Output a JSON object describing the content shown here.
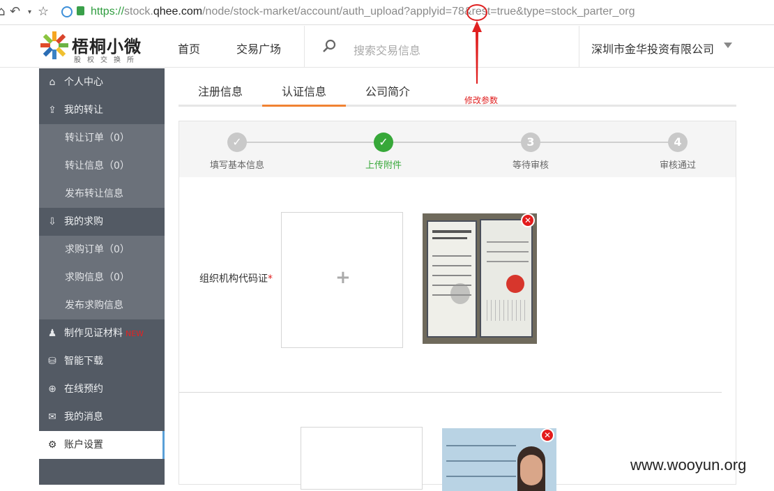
{
  "browser": {
    "url_scheme": "https://",
    "url_host_prefix": "stock.",
    "url_host_domain": "qhee.com",
    "url_path": "/node/stock-market/account/auth_upload?applyid=78&rest=true&type=stock_parter_org"
  },
  "header": {
    "logo_title": "梧桐小微",
    "logo_subtitle": "股权交换所",
    "nav": [
      "首页",
      "交易广场"
    ],
    "search_placeholder": "搜索交易信息",
    "company": "深圳市金华投资有限公司"
  },
  "sidebar": {
    "items": [
      {
        "label": "个人中心",
        "icon": "home-icon",
        "type": "main"
      },
      {
        "label": "我的转让",
        "icon": "upload-icon",
        "type": "main"
      },
      {
        "label": "转让订单（0）",
        "type": "sub"
      },
      {
        "label": "转让信息（0）",
        "type": "sub"
      },
      {
        "label": "发布转让信息",
        "type": "sub"
      },
      {
        "label": "我的求购",
        "icon": "download-icon",
        "type": "main"
      },
      {
        "label": "求购订单（0）",
        "type": "sub"
      },
      {
        "label": "求购信息（0）",
        "type": "sub"
      },
      {
        "label": "发布求购信息",
        "type": "sub"
      },
      {
        "label": "制作见证材料",
        "icon": "person-icon",
        "type": "main",
        "badge": "NEW"
      },
      {
        "label": "智能下载",
        "icon": "drive-icon",
        "type": "main"
      },
      {
        "label": "在线预约",
        "icon": "globe-icon",
        "type": "main"
      },
      {
        "label": "我的消息",
        "icon": "mail-icon",
        "type": "main"
      },
      {
        "label": "账户设置",
        "icon": "gear-icon",
        "type": "main",
        "active": true
      }
    ]
  },
  "tabs": [
    "注册信息",
    "认证信息",
    "公司简介"
  ],
  "active_tab": "认证信息",
  "annotation": "修改参数",
  "steps": [
    {
      "label": "填写基本信息",
      "state": "done",
      "symbol": "✓"
    },
    {
      "label": "上传附件",
      "state": "current",
      "symbol": "✓"
    },
    {
      "label": "等待审核",
      "state": "todo",
      "symbol": "3"
    },
    {
      "label": "审核通过",
      "state": "todo",
      "symbol": "4"
    }
  ],
  "uploads": [
    {
      "label": "组织机构代码证",
      "required_mark": "*"
    }
  ],
  "watermark": "www.wooyun.org",
  "colors": {
    "sidebar_bg": "#535a64",
    "sidebar_sub_bg": "#6b717a",
    "accent_orange": "#f08232",
    "step_green": "#37a839",
    "annotation_red": "#e02020"
  }
}
